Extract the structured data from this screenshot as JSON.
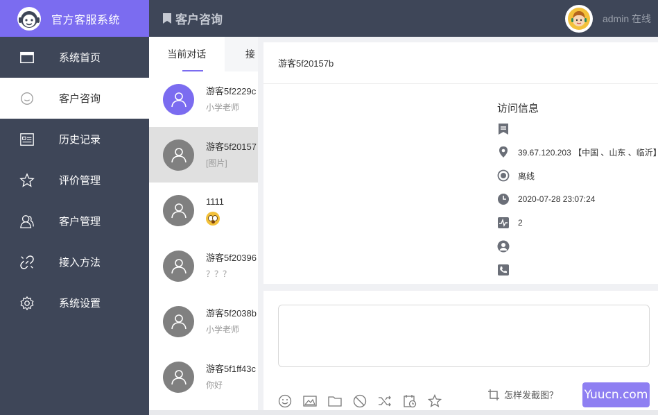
{
  "app": {
    "title": "官方客服系统"
  },
  "sidebar": {
    "items": [
      {
        "label": "系统首页",
        "icon": "window-icon"
      },
      {
        "label": "客户咨询",
        "icon": "chat-bubble-icon"
      },
      {
        "label": "历史记录",
        "icon": "history-icon"
      },
      {
        "label": "评价管理",
        "icon": "star-icon"
      },
      {
        "label": "客户管理",
        "icon": "users-icon"
      },
      {
        "label": "接入方法",
        "icon": "link-icon"
      },
      {
        "label": "系统设置",
        "icon": "gear-icon"
      }
    ],
    "active_index": 1
  },
  "header": {
    "title": "客户咨询",
    "admin_status": "admin 在线"
  },
  "conversations": {
    "tabs": [
      "当前对话",
      "接"
    ],
    "items": [
      {
        "name": "游客5f2229c",
        "sub": "小学老师",
        "avatar": "purple"
      },
      {
        "name": "游客5f20157",
        "sub": "[图片]",
        "avatar": "gray",
        "selected": true
      },
      {
        "name": "1111",
        "sub": "",
        "avatar": "gray",
        "emoji": true
      },
      {
        "name": "游客5f20396",
        "sub": "？？？",
        "avatar": "gray"
      },
      {
        "name": "游客5f2038b",
        "sub": "小学老师",
        "avatar": "gray"
      },
      {
        "name": "游客5f1ff43c",
        "sub": "你好",
        "avatar": "gray"
      }
    ]
  },
  "chat": {
    "visitor": "游客5f20157b",
    "visit_info": {
      "title": "访问信息",
      "ip": "39.67.120.203 【中国 、山东 、临沂】",
      "status": "离线",
      "time": "2020-07-28 23:07:24",
      "visits": "2"
    },
    "screenshot_hint": "怎样发截图？",
    "send_watermark": "Yuucn.com"
  },
  "colors": {
    "accent": "#7b6cf0",
    "sidebar": "#3e4658"
  }
}
